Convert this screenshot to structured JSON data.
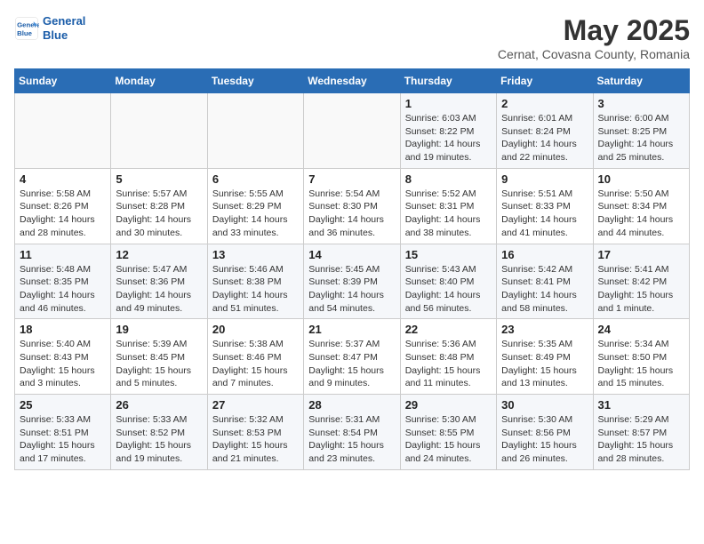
{
  "header": {
    "logo_line1": "General",
    "logo_line2": "Blue",
    "month": "May 2025",
    "location": "Cernat, Covasna County, Romania"
  },
  "days_of_week": [
    "Sunday",
    "Monday",
    "Tuesday",
    "Wednesday",
    "Thursday",
    "Friday",
    "Saturday"
  ],
  "weeks": [
    [
      {
        "day": "",
        "info": ""
      },
      {
        "day": "",
        "info": ""
      },
      {
        "day": "",
        "info": ""
      },
      {
        "day": "",
        "info": ""
      },
      {
        "day": "1",
        "info": "Sunrise: 6:03 AM\nSunset: 8:22 PM\nDaylight: 14 hours\nand 19 minutes."
      },
      {
        "day": "2",
        "info": "Sunrise: 6:01 AM\nSunset: 8:24 PM\nDaylight: 14 hours\nand 22 minutes."
      },
      {
        "day": "3",
        "info": "Sunrise: 6:00 AM\nSunset: 8:25 PM\nDaylight: 14 hours\nand 25 minutes."
      }
    ],
    [
      {
        "day": "4",
        "info": "Sunrise: 5:58 AM\nSunset: 8:26 PM\nDaylight: 14 hours\nand 28 minutes."
      },
      {
        "day": "5",
        "info": "Sunrise: 5:57 AM\nSunset: 8:28 PM\nDaylight: 14 hours\nand 30 minutes."
      },
      {
        "day": "6",
        "info": "Sunrise: 5:55 AM\nSunset: 8:29 PM\nDaylight: 14 hours\nand 33 minutes."
      },
      {
        "day": "7",
        "info": "Sunrise: 5:54 AM\nSunset: 8:30 PM\nDaylight: 14 hours\nand 36 minutes."
      },
      {
        "day": "8",
        "info": "Sunrise: 5:52 AM\nSunset: 8:31 PM\nDaylight: 14 hours\nand 38 minutes."
      },
      {
        "day": "9",
        "info": "Sunrise: 5:51 AM\nSunset: 8:33 PM\nDaylight: 14 hours\nand 41 minutes."
      },
      {
        "day": "10",
        "info": "Sunrise: 5:50 AM\nSunset: 8:34 PM\nDaylight: 14 hours\nand 44 minutes."
      }
    ],
    [
      {
        "day": "11",
        "info": "Sunrise: 5:48 AM\nSunset: 8:35 PM\nDaylight: 14 hours\nand 46 minutes."
      },
      {
        "day": "12",
        "info": "Sunrise: 5:47 AM\nSunset: 8:36 PM\nDaylight: 14 hours\nand 49 minutes."
      },
      {
        "day": "13",
        "info": "Sunrise: 5:46 AM\nSunset: 8:38 PM\nDaylight: 14 hours\nand 51 minutes."
      },
      {
        "day": "14",
        "info": "Sunrise: 5:45 AM\nSunset: 8:39 PM\nDaylight: 14 hours\nand 54 minutes."
      },
      {
        "day": "15",
        "info": "Sunrise: 5:43 AM\nSunset: 8:40 PM\nDaylight: 14 hours\nand 56 minutes."
      },
      {
        "day": "16",
        "info": "Sunrise: 5:42 AM\nSunset: 8:41 PM\nDaylight: 14 hours\nand 58 minutes."
      },
      {
        "day": "17",
        "info": "Sunrise: 5:41 AM\nSunset: 8:42 PM\nDaylight: 15 hours\nand 1 minute."
      }
    ],
    [
      {
        "day": "18",
        "info": "Sunrise: 5:40 AM\nSunset: 8:43 PM\nDaylight: 15 hours\nand 3 minutes."
      },
      {
        "day": "19",
        "info": "Sunrise: 5:39 AM\nSunset: 8:45 PM\nDaylight: 15 hours\nand 5 minutes."
      },
      {
        "day": "20",
        "info": "Sunrise: 5:38 AM\nSunset: 8:46 PM\nDaylight: 15 hours\nand 7 minutes."
      },
      {
        "day": "21",
        "info": "Sunrise: 5:37 AM\nSunset: 8:47 PM\nDaylight: 15 hours\nand 9 minutes."
      },
      {
        "day": "22",
        "info": "Sunrise: 5:36 AM\nSunset: 8:48 PM\nDaylight: 15 hours\nand 11 minutes."
      },
      {
        "day": "23",
        "info": "Sunrise: 5:35 AM\nSunset: 8:49 PM\nDaylight: 15 hours\nand 13 minutes."
      },
      {
        "day": "24",
        "info": "Sunrise: 5:34 AM\nSunset: 8:50 PM\nDaylight: 15 hours\nand 15 minutes."
      }
    ],
    [
      {
        "day": "25",
        "info": "Sunrise: 5:33 AM\nSunset: 8:51 PM\nDaylight: 15 hours\nand 17 minutes."
      },
      {
        "day": "26",
        "info": "Sunrise: 5:33 AM\nSunset: 8:52 PM\nDaylight: 15 hours\nand 19 minutes."
      },
      {
        "day": "27",
        "info": "Sunrise: 5:32 AM\nSunset: 8:53 PM\nDaylight: 15 hours\nand 21 minutes."
      },
      {
        "day": "28",
        "info": "Sunrise: 5:31 AM\nSunset: 8:54 PM\nDaylight: 15 hours\nand 23 minutes."
      },
      {
        "day": "29",
        "info": "Sunrise: 5:30 AM\nSunset: 8:55 PM\nDaylight: 15 hours\nand 24 minutes."
      },
      {
        "day": "30",
        "info": "Sunrise: 5:30 AM\nSunset: 8:56 PM\nDaylight: 15 hours\nand 26 minutes."
      },
      {
        "day": "31",
        "info": "Sunrise: 5:29 AM\nSunset: 8:57 PM\nDaylight: 15 hours\nand 28 minutes."
      }
    ]
  ]
}
